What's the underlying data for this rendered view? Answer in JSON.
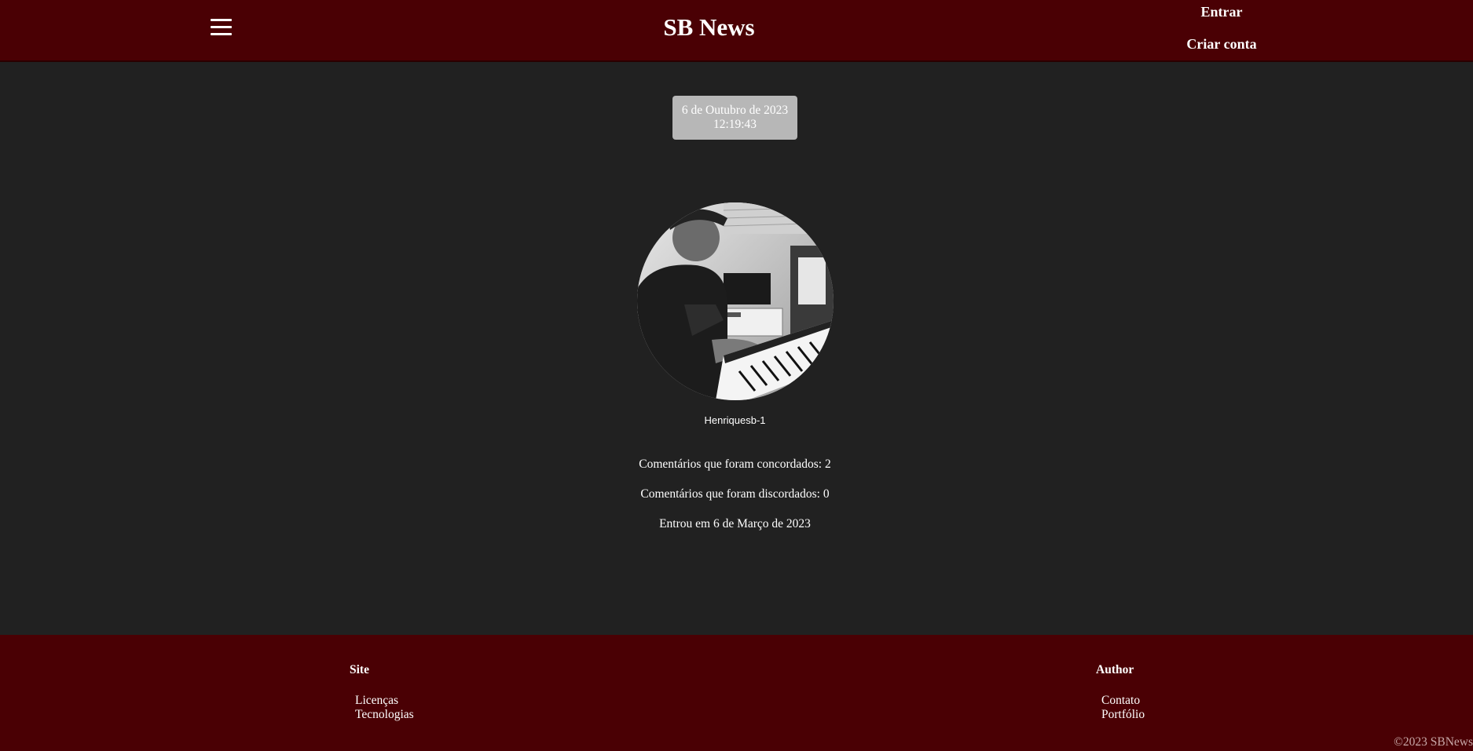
{
  "header": {
    "title": "SB News",
    "menu_icon": "hamburger-menu-icon",
    "login_label": "Entrar",
    "signup_label": "Criar conta"
  },
  "clock": {
    "date": "6 de Outubro de 2023",
    "time": "12:19:43"
  },
  "profile": {
    "avatar_description": "avatar-photo",
    "username": "Henriquesb-1",
    "agreed_comments": "Comentários que foram concordados: 2",
    "disagreed_comments": "Comentários que foram discordados: 0",
    "joined": "Entrou em 6 de Março de 2023"
  },
  "footer": {
    "site": {
      "heading": "Site",
      "links": [
        "Licenças",
        "Tecnologias"
      ]
    },
    "author": {
      "heading": "Author",
      "links": [
        "Contato",
        "Portfólio"
      ]
    },
    "copyright": "©2023 SBNews"
  },
  "colors": {
    "header_bg": "#4a0004",
    "page_bg": "#212121",
    "datebox_bg": "#b7b7b7"
  }
}
